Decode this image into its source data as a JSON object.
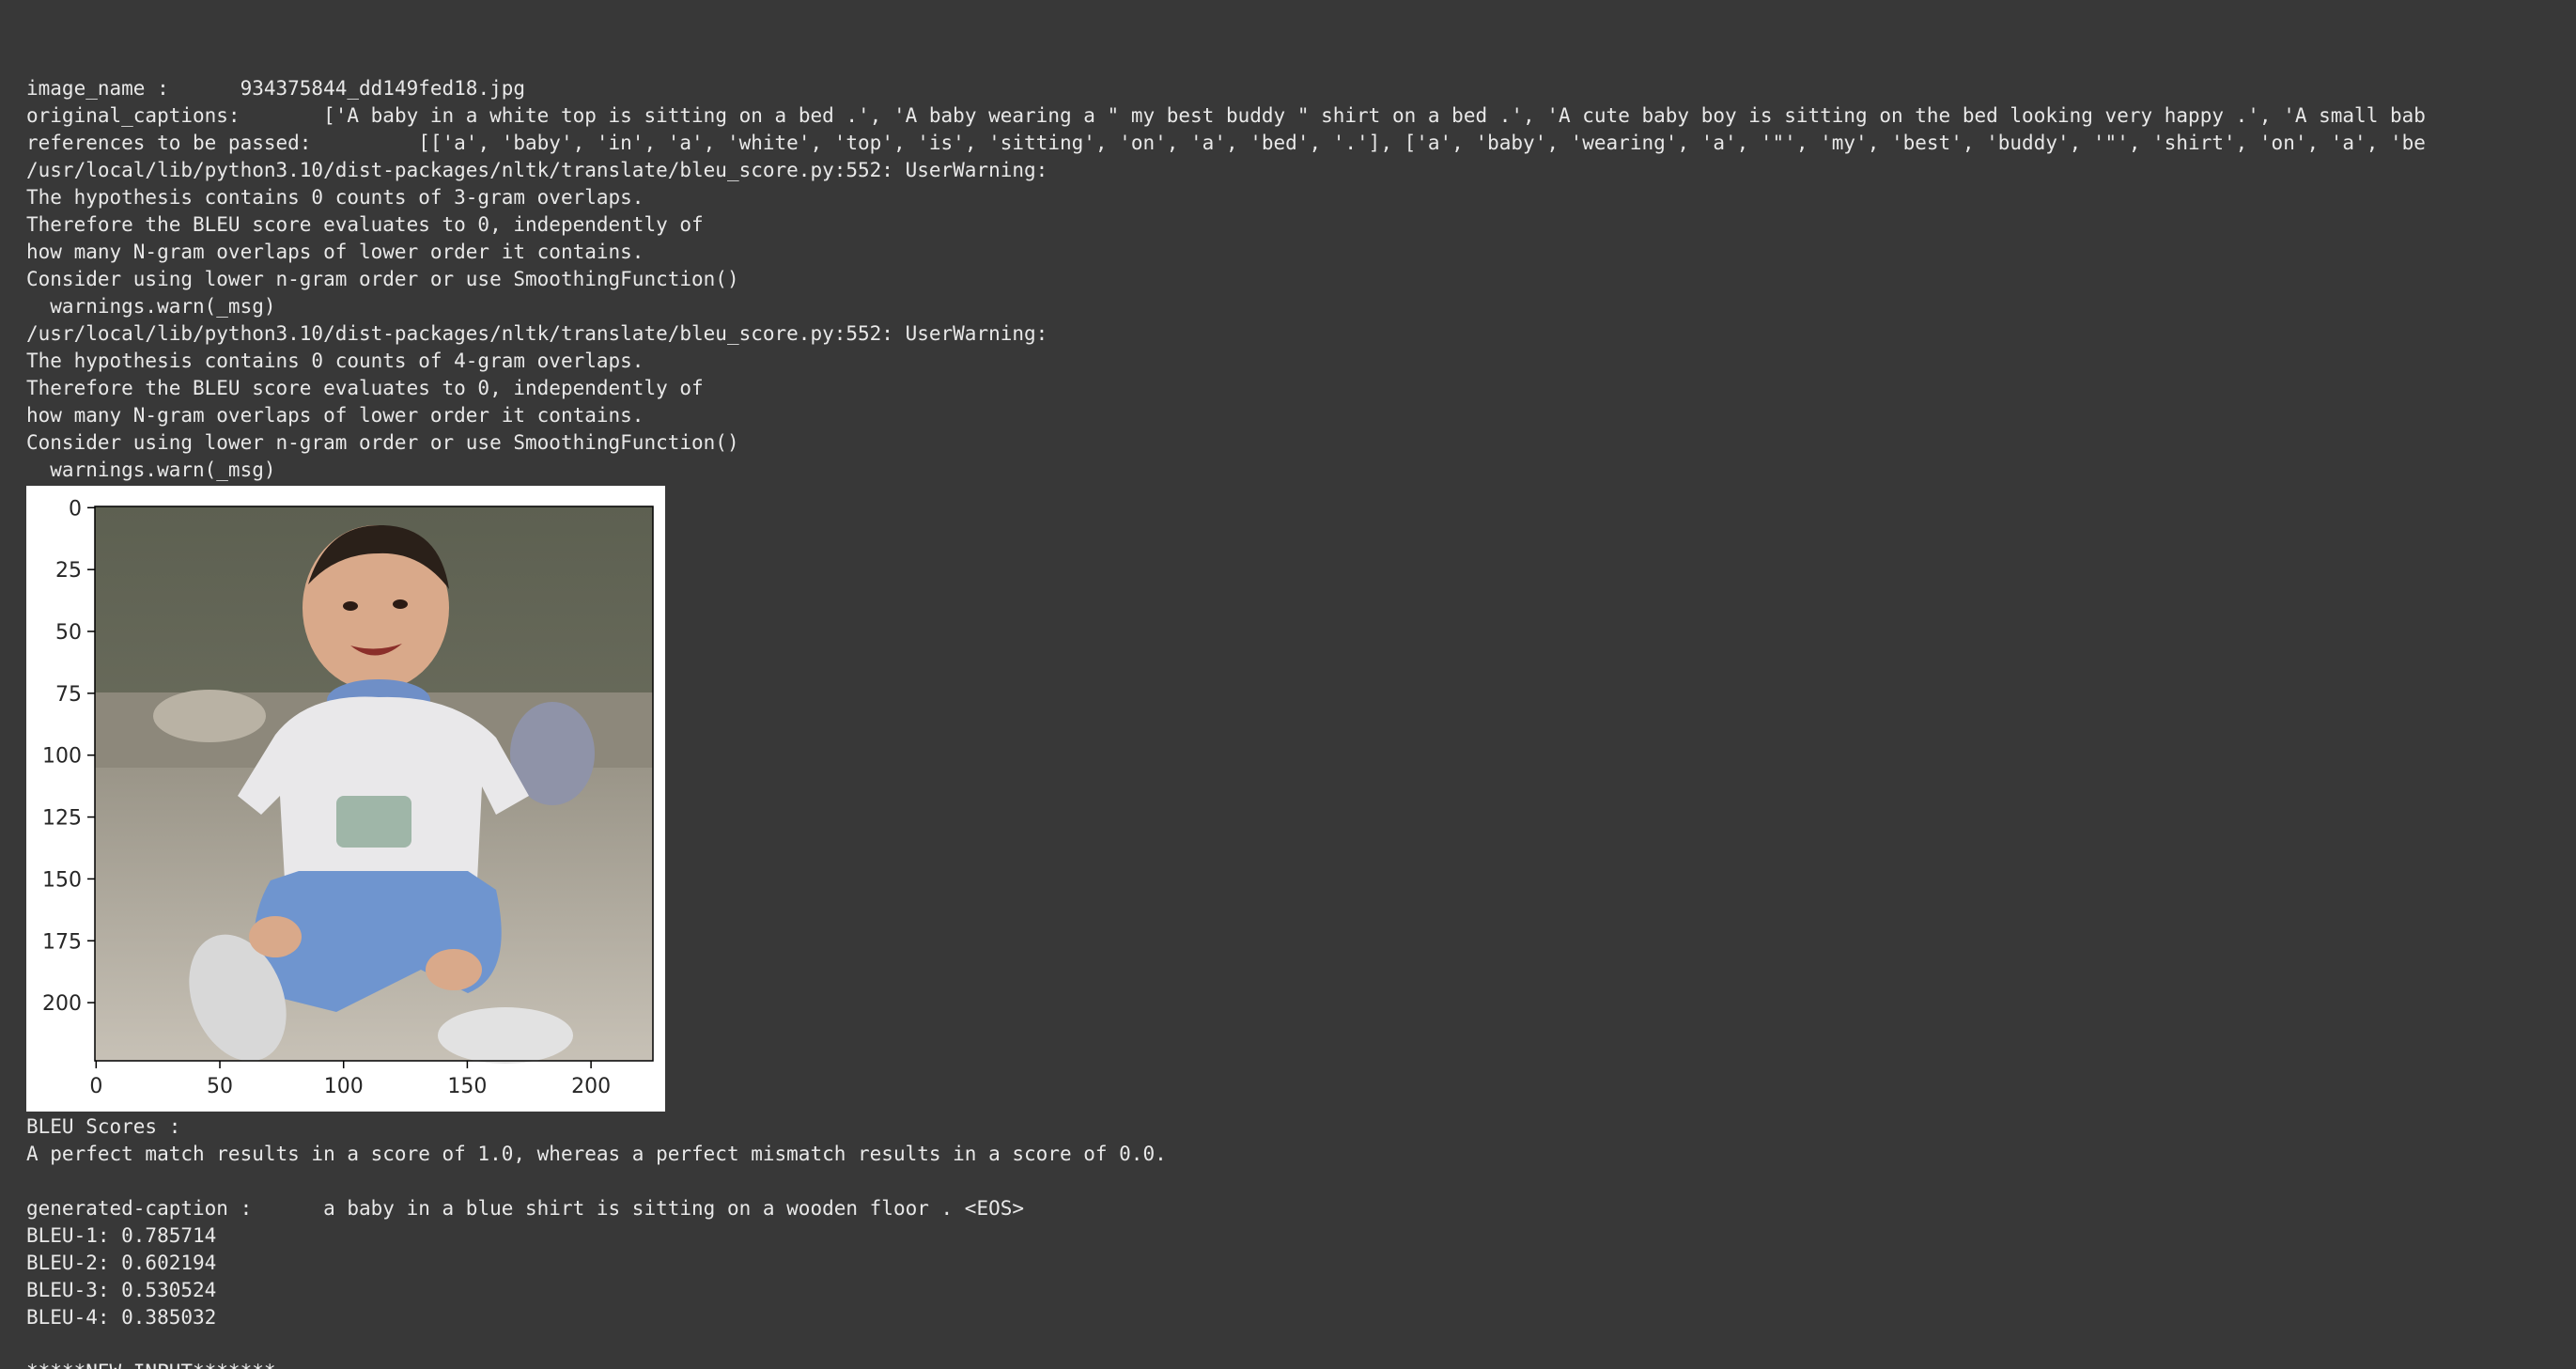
{
  "cell_output": {
    "image_name_label": "image_name :",
    "image_name_value": "934375844_dd149fed18.jpg",
    "original_captions_label": "original_captions:",
    "original_captions_value": "['A baby in a white top is sitting on a bed .', 'A baby wearing a \" my best buddy \" shirt on a bed .', 'A cute baby boy is sitting on the bed looking very happy .', 'A small bab",
    "references_label": "references to be passed:",
    "references_value": "[['a', 'baby', 'in', 'a', 'white', 'top', 'is', 'sitting', 'on', 'a', 'bed', '.'], ['a', 'baby', 'wearing', 'a', '\"', 'my', 'best', 'buddy', '\"', 'shirt', 'on', 'a', 'be",
    "warning_blocks": [
      {
        "path": "/usr/local/lib/python3.10/dist-packages/nltk/translate/bleu_score.py:552: UserWarning:",
        "lines": [
          "The hypothesis contains 0 counts of 3-gram overlaps.",
          "Therefore the BLEU score evaluates to 0, independently of",
          "how many N-gram overlaps of lower order it contains.",
          "Consider using lower n-gram order or use SmoothingFunction()",
          "  warnings.warn(_msg)"
        ]
      },
      {
        "path": "/usr/local/lib/python3.10/dist-packages/nltk/translate/bleu_score.py:552: UserWarning:",
        "lines": [
          "The hypothesis contains 0 counts of 4-gram overlaps.",
          "Therefore the BLEU score evaluates to 0, independently of",
          "how many N-gram overlaps of lower order it contains.",
          "Consider using lower n-gram order or use SmoothingFunction()",
          "  warnings.warn(_msg)"
        ]
      }
    ],
    "plot": {
      "y_ticks": [
        "0",
        "25",
        "50",
        "75",
        "100",
        "125",
        "150",
        "175",
        "200"
      ],
      "x_ticks": [
        "0",
        "50",
        "100",
        "150",
        "200"
      ]
    },
    "bleu_header": "BLEU Scores :",
    "bleu_note": "A perfect match results in a score of 1.0, whereas a perfect mismatch results in a score of 0.0.",
    "generated_caption_label": "generated-caption :",
    "generated_caption_value": "a baby in a blue shirt is sitting on a wooden floor . <EOS>",
    "scores": [
      "BLEU-1: 0.785714",
      "BLEU-2: 0.602194",
      "BLEU-3: 0.530524",
      "BLEU-4: 0.385032"
    ],
    "new_input_marker": "*****NEW INPUT*******"
  }
}
